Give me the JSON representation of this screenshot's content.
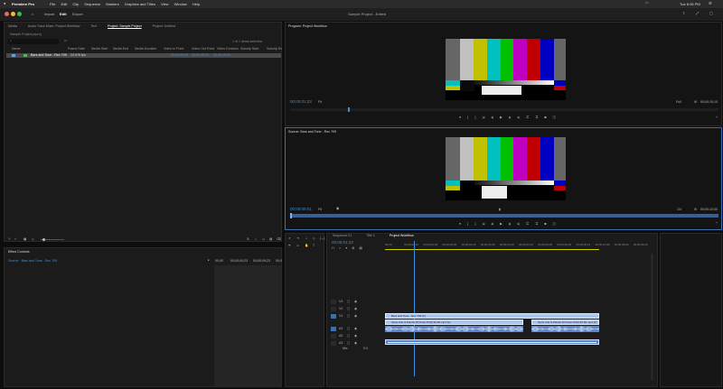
{
  "menubar": {
    "apple": "",
    "app_name": "Premiere Pro",
    "items": [
      "File",
      "Edit",
      "Clip",
      "Sequence",
      "Markers",
      "Graphics and Titles",
      "View",
      "Window",
      "Help"
    ],
    "clock": "Tue 8:06 PM"
  },
  "titlebar": {
    "tabs": [
      "Import",
      "Edit",
      "Export"
    ],
    "active_tab": "Edit",
    "window_title": "Sample Project - Edited"
  },
  "project_panel": {
    "tabs": [
      "Media",
      "Audio Track Mixer: Project Workflow",
      "Text",
      "Project: Sample Project",
      "Project: Untitled"
    ],
    "active_tab": "Project: Sample Project",
    "file_name": "Sample Project.prproj",
    "search_placeholder": "",
    "item_count": "1 of 1 items selected",
    "columns": [
      "Name",
      "Frame Rate",
      "Media Start",
      "Media End",
      "Media Duration",
      "Video In Point",
      "Video Out Point",
      "Video Duration",
      "Subclip Start",
      "Subclip En"
    ],
    "rows": [
      {
        "name": "Bars and Tone - Rec 709",
        "fps": "23.976 fps",
        "in": "00;00;00;00",
        "out": "00;00;09;23",
        "dur": "00;00;10;00"
      }
    ]
  },
  "effect_controls": {
    "tab": "Effect Controls",
    "source_label": "Source · Bars and Tone - Rec 709",
    "timecodes": [
      "00;00",
      "00;00;04;23",
      "00;00;09;23",
      "00;0"
    ]
  },
  "program_monitor": {
    "tab": "Program: Project Workflow",
    "timecode": "00;00;01;23",
    "zoom": "Fit",
    "duration": "00;00;10;10",
    "fraction": "Full"
  },
  "source_monitor": {
    "tab": "Source: Bars and Tone - Rec 709",
    "timecode": "00;00;00;01",
    "zoom": "Fit",
    "duration": "00;00;10;00",
    "fraction": "1/4"
  },
  "timeline": {
    "tabs": [
      "Sequence 01",
      "Title 1",
      "Project Workflow"
    ],
    "active_tab": "Project Workflow",
    "timecode": "00;00;01;23",
    "ruler": [
      "00;00",
      "00;00;00;16",
      "00;00;01;08",
      "00;00;02;00",
      "00;00;02;16",
      "00;00;03;08",
      "00;00;04;00",
      "00;00;04;16",
      "00;00;05;08",
      "00;00;06;00",
      "00;00;06;16",
      "00;00;07;08",
      "00;00;08;00",
      "00;00;08;16"
    ],
    "tracks_video": [
      "V3",
      "V2",
      "V1"
    ],
    "tracks_audio": [
      "A1",
      "A2",
      "A3"
    ],
    "mix_label": "Mix",
    "mix_value": "0.0",
    "clips": {
      "v2": "Bars and Tone - Rec 709 [V]",
      "v1a": "Opus Arte & Pianist [N Dovin Pistl] 30-60.mp4 [V]",
      "v1b": "Opus Arte & Pianist [N Dovin Pistl] 30-60.mp4 [V]"
    }
  },
  "colors": {
    "accent": "#3b8fe0",
    "clip_video": "#a9c5ee",
    "clip_audio": "#5c84c8",
    "audio_wave": "#6fa0d8"
  },
  "bars_colors": [
    "#c0c0c0",
    "#c0c000",
    "#00c0c0",
    "#00c000",
    "#c000c0",
    "#c00000",
    "#0000c0"
  ]
}
